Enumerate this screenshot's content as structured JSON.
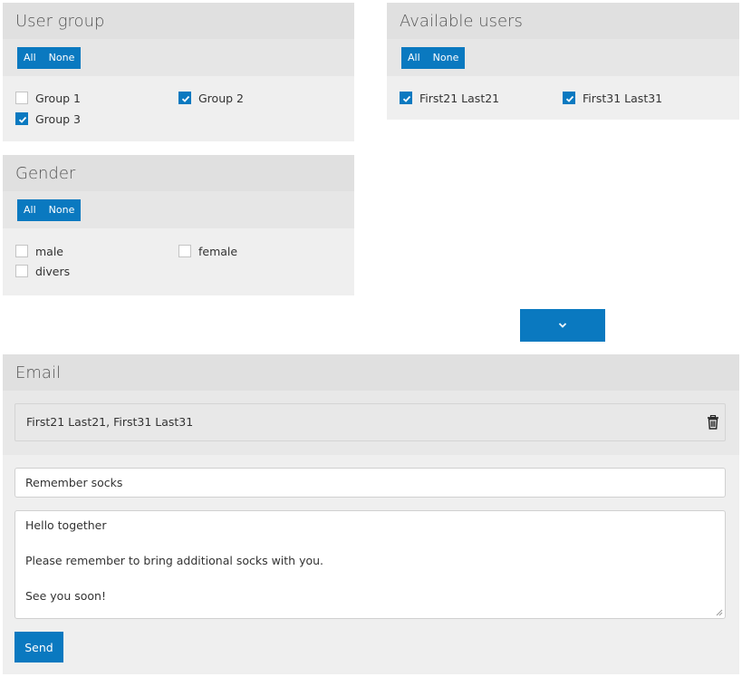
{
  "user_group": {
    "title": "User group",
    "all_label": "All",
    "none_label": "None",
    "options": [
      {
        "label": "Group 1",
        "checked": false
      },
      {
        "label": "Group 2",
        "checked": true
      },
      {
        "label": "Group 3",
        "checked": true
      }
    ]
  },
  "available_users": {
    "title": "Available users",
    "all_label": "All",
    "none_label": "None",
    "options": [
      {
        "label": "First21 Last21",
        "checked": true
      },
      {
        "label": "First31 Last31",
        "checked": true
      }
    ]
  },
  "gender": {
    "title": "Gender",
    "all_label": "All",
    "none_label": "None",
    "options": [
      {
        "label": "male",
        "checked": false
      },
      {
        "label": "female",
        "checked": false
      },
      {
        "label": "divers",
        "checked": false
      }
    ]
  },
  "collapse_icon": "chevron-down-icon",
  "email": {
    "title": "Email",
    "recipients": "First21 Last21,  First31 Last31",
    "subject": "Remember socks",
    "body_lines": [
      "Hello together",
      "",
      "Please remember to bring additional socks with you.",
      "",
      "See you soon!"
    ],
    "send_label": "Send",
    "trash_icon": "trash-icon"
  },
  "colors": {
    "accent": "#0a79c0",
    "panel": "#efefef",
    "panel_header": "#e0e0e0"
  }
}
